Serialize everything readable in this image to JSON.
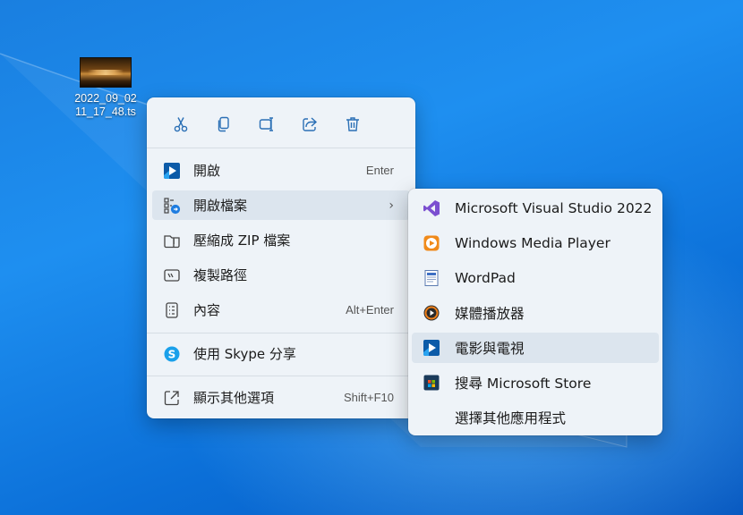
{
  "desktop": {
    "file_icon": {
      "name_line1": "2022_09_02",
      "name_line2": "11_17_48.ts",
      "icon": "video-thumbnail-icon"
    }
  },
  "context_menu": {
    "toolbar": [
      {
        "icon": "cut-icon",
        "action": "cut"
      },
      {
        "icon": "copy-icon",
        "action": "copy"
      },
      {
        "icon": "rename-icon",
        "action": "rename"
      },
      {
        "icon": "share-icon",
        "action": "share"
      },
      {
        "icon": "delete-icon",
        "action": "delete"
      }
    ],
    "items": [
      {
        "label": "開啟",
        "shortcut": "Enter",
        "icon": "movies-tv-app-icon"
      },
      {
        "label": "開啟檔案",
        "shortcut": "",
        "icon": "open-with-icon",
        "has_submenu": true
      },
      {
        "label": "壓縮成 ZIP 檔案",
        "shortcut": "",
        "icon": "zip-folder-icon"
      },
      {
        "label": "複製路徑",
        "shortcut": "",
        "icon": "copy-path-icon"
      },
      {
        "label": "內容",
        "shortcut": "Alt+Enter",
        "icon": "properties-icon"
      },
      {
        "label": "使用 Skype 分享",
        "shortcut": "",
        "icon": "skype-icon"
      },
      {
        "label": "顯示其他選項",
        "shortcut": "Shift+F10",
        "icon": "more-options-icon"
      }
    ]
  },
  "submenu": {
    "items": [
      {
        "label": "Microsoft Visual Studio 2022",
        "icon": "visual-studio-icon"
      },
      {
        "label": "Windows Media Player",
        "icon": "windows-media-player-icon"
      },
      {
        "label": "WordPad",
        "icon": "wordpad-icon"
      },
      {
        "label": "媒體播放器",
        "icon": "media-player-icon"
      },
      {
        "label": "電影與電視",
        "icon": "movies-tv-app-icon"
      },
      {
        "label": "搜尋 Microsoft Store",
        "icon": "microsoft-store-icon"
      },
      {
        "label": "選擇其他應用程式",
        "icon": ""
      }
    ]
  },
  "colors": {
    "desktop_bg": "#1a7fe0",
    "menu_bg": "#eef3f8",
    "hover_bg": "#dce5ee",
    "accent": "#0a6cc8"
  }
}
